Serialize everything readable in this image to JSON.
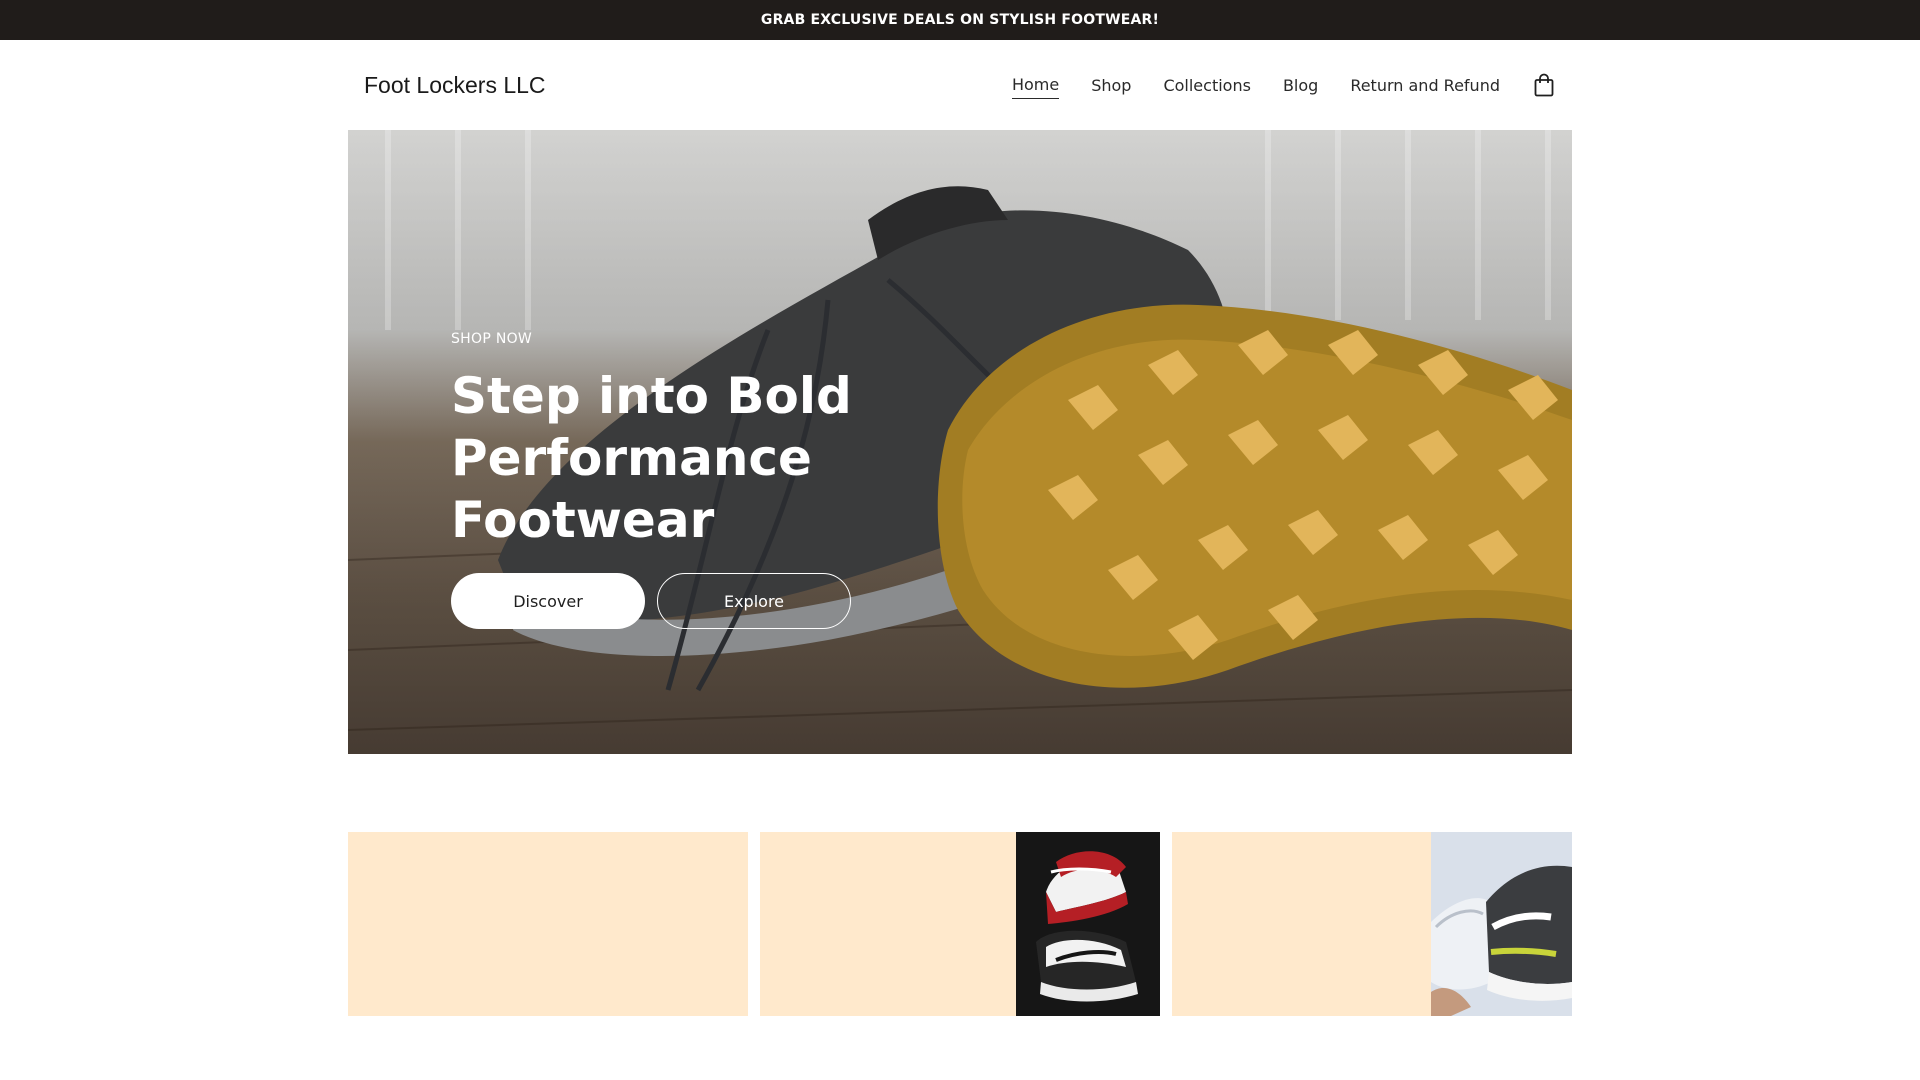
{
  "announcement": "GRAB EXCLUSIVE DEALS ON STYLISH FOOTWEAR!",
  "header": {
    "logo": "Foot Lockers LLC",
    "nav": [
      {
        "label": "Home",
        "active": true
      },
      {
        "label": "Shop",
        "active": false
      },
      {
        "label": "Collections",
        "active": false
      },
      {
        "label": "Blog",
        "active": false
      },
      {
        "label": "Return and Refund",
        "active": false
      }
    ],
    "cart_icon": "shopping-bag-icon"
  },
  "hero": {
    "kicker": "SHOP NOW",
    "headline": "Step into Bold Performance Footwear",
    "primary_button": "Discover",
    "secondary_button": "Explore"
  },
  "cards": [
    {
      "image": "none"
    },
    {
      "image": "sneaker-black-red-white"
    },
    {
      "image": "sneaker-white-grey-hand"
    }
  ],
  "colors": {
    "announcement_bg": "#201c1a",
    "card_bg": "#ffe9cc",
    "text": "#1f1f1f",
    "white": "#ffffff"
  }
}
